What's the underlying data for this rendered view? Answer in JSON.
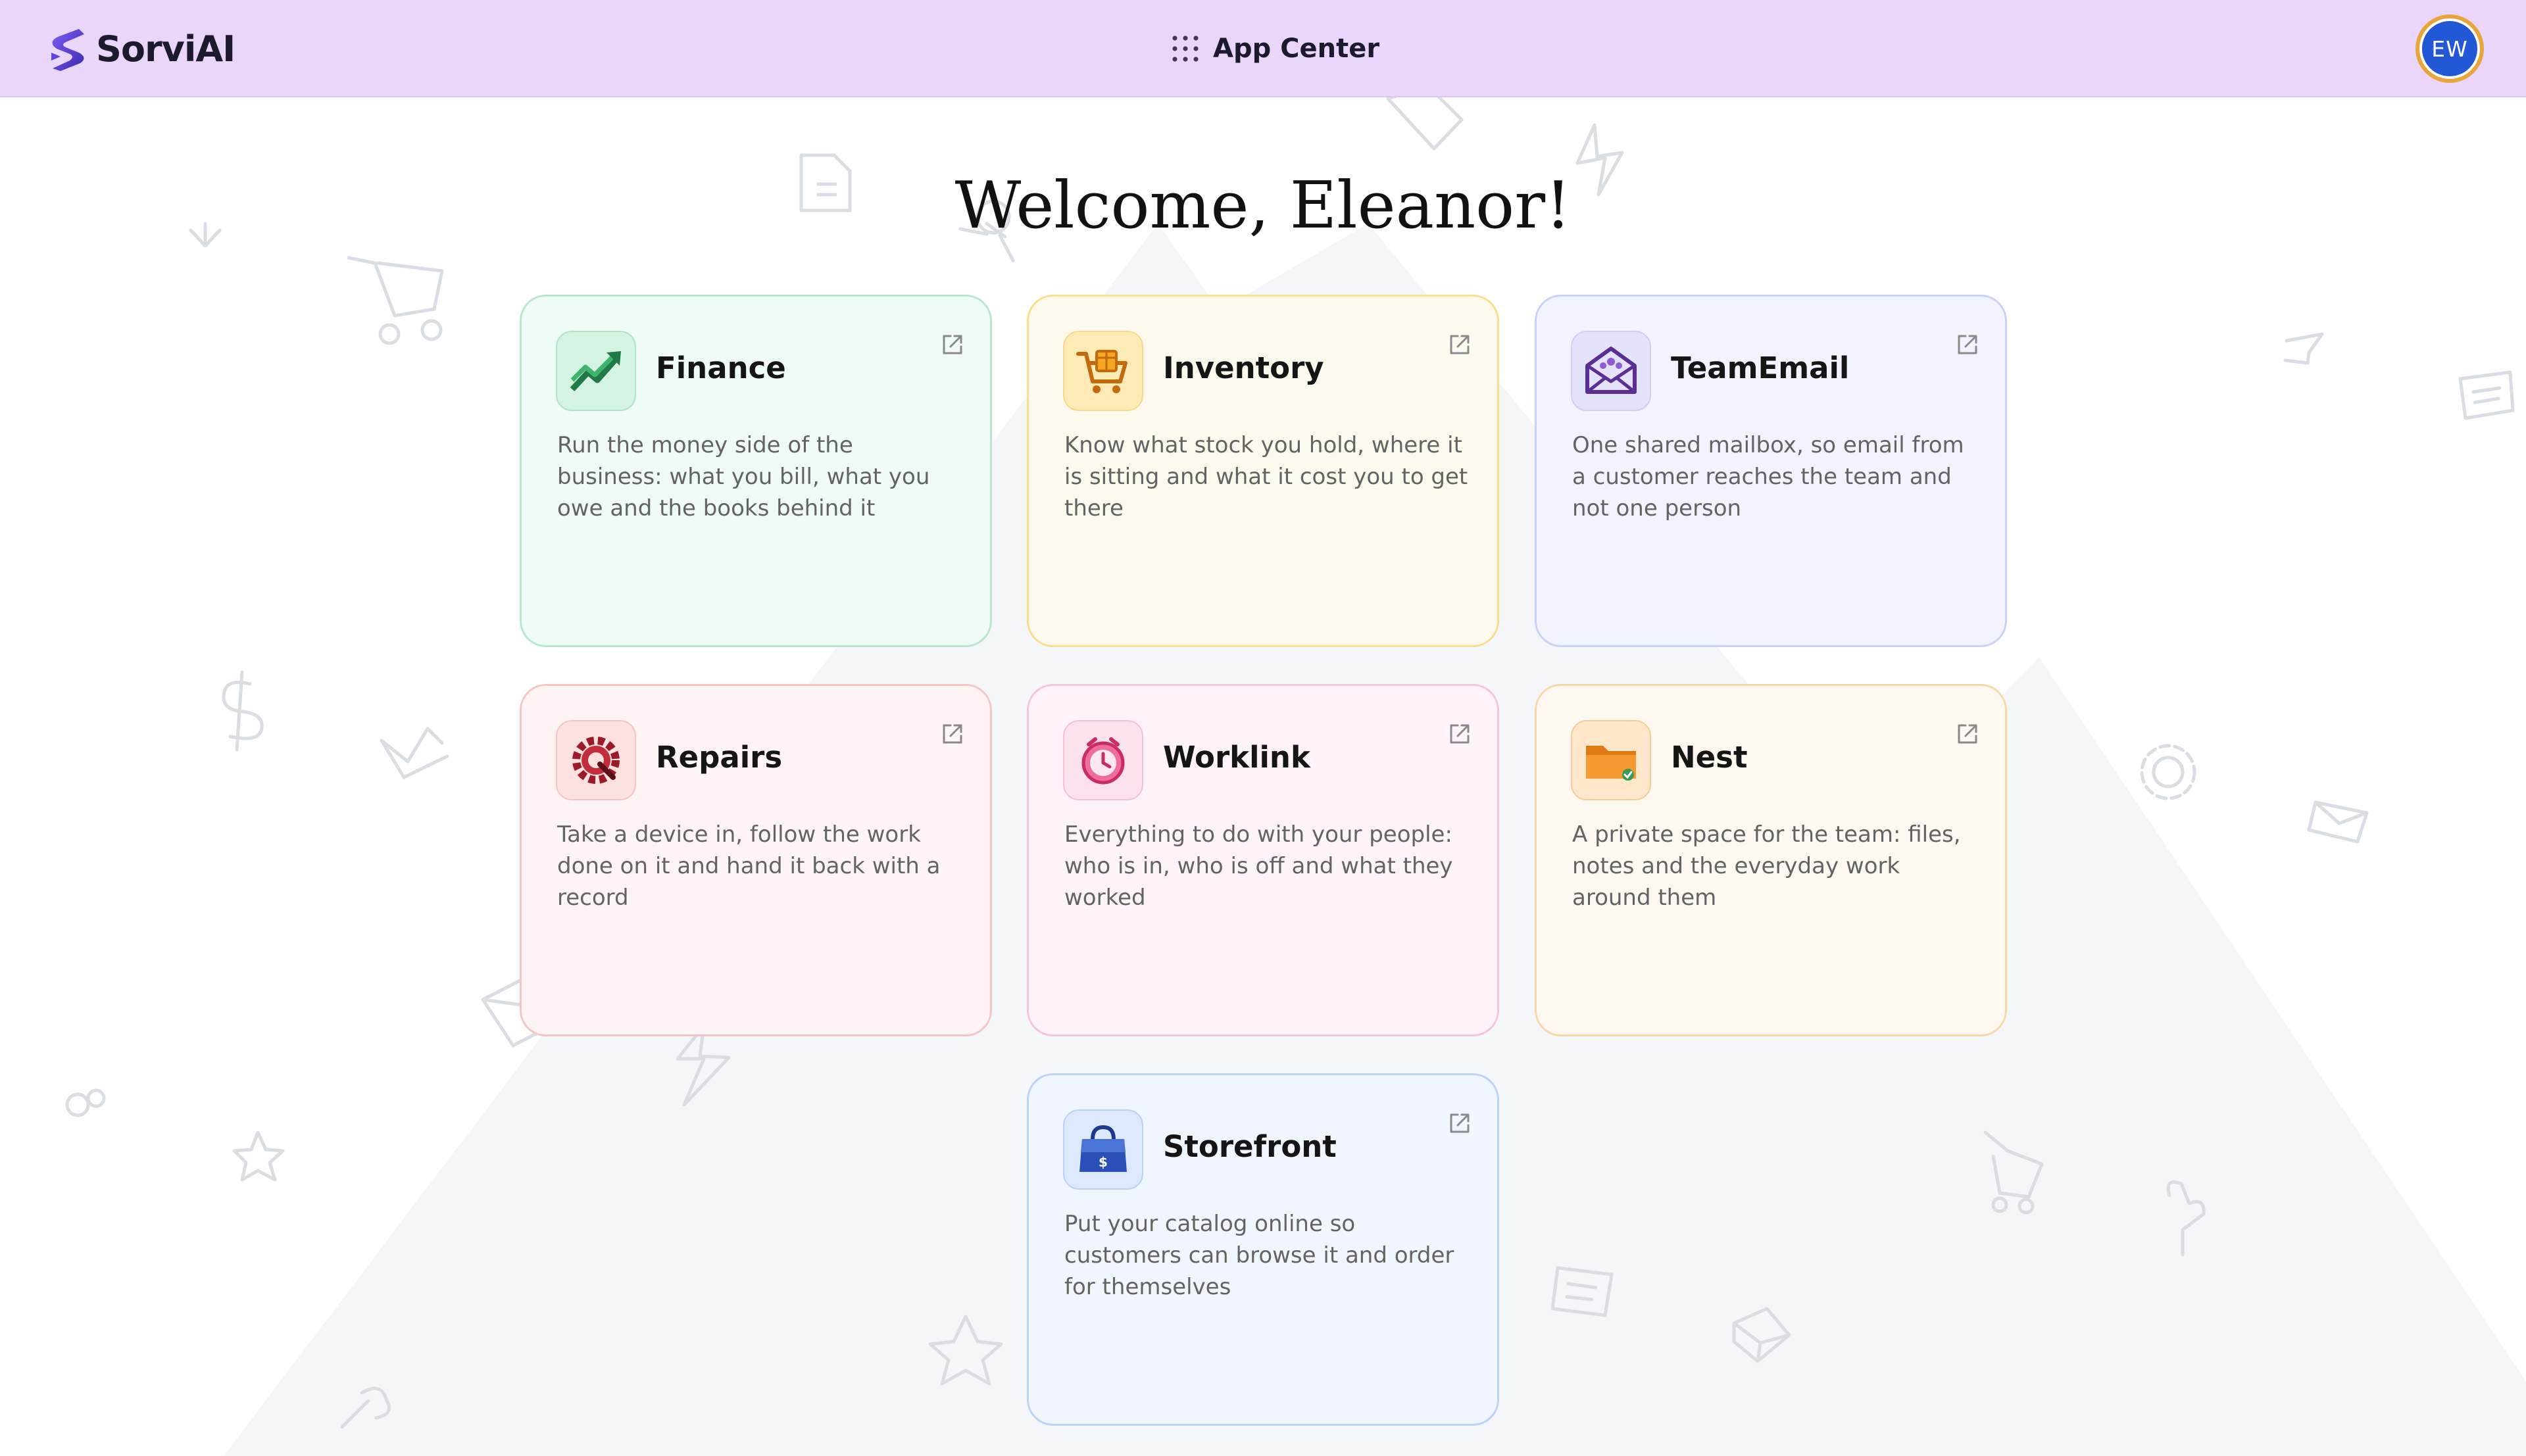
{
  "header": {
    "brand_name": "SorviAI",
    "app_center_label": "App Center",
    "user_initials": "EW"
  },
  "welcome_text": "Welcome, Eleanor!",
  "apps": [
    {
      "key": "finance",
      "title": "Finance",
      "description": "Run the money side of the business: what you bill, what you owe and the books behind it",
      "icon": "trend-chart-icon",
      "accent": "#3ea86a"
    },
    {
      "key": "inventory",
      "title": "Inventory",
      "description": "Know what stock you hold, where it is sitting and what it cost you to get there",
      "icon": "cart-box-icon",
      "accent": "#f3a316"
    },
    {
      "key": "teamemail",
      "title": "TeamEmail",
      "description": "One shared mailbox, so email from a customer reaches the team and not one person",
      "icon": "envelope-team-icon",
      "accent": "#6c3ba8"
    },
    {
      "key": "repairs",
      "title": "Repairs",
      "description": "Take a device in, follow the work done on it and hand it back with a record",
      "icon": "gear-wrench-icon",
      "accent": "#b8232f"
    },
    {
      "key": "worklink",
      "title": "Worklink",
      "description": "Everything to do with your people: who is in, who is off and what they worked",
      "icon": "clock-icon",
      "accent": "#e0457f"
    },
    {
      "key": "nest",
      "title": "Nest",
      "description": "A private space for the team: files, notes and the everyday work around them",
      "icon": "folder-icon",
      "accent": "#f08a24"
    },
    {
      "key": "storefront",
      "title": "Storefront",
      "description": "Put your catalog online so customers can browse it and order for themselves",
      "icon": "shopping-bag-icon",
      "accent": "#2a4fb8"
    }
  ]
}
